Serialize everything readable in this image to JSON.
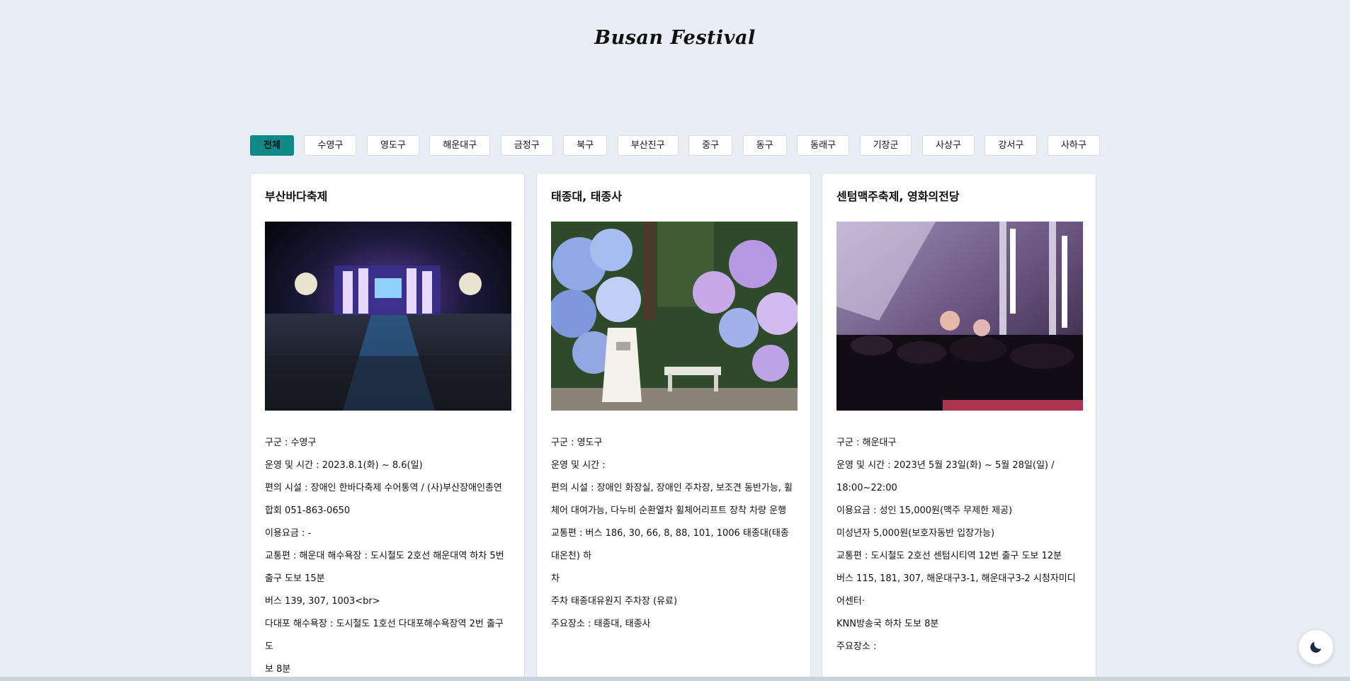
{
  "header": {
    "title": "Busan Festival"
  },
  "filters": [
    {
      "label": "전체",
      "active": true
    },
    {
      "label": "수영구"
    },
    {
      "label": "영도구"
    },
    {
      "label": "해운대구"
    },
    {
      "label": "금정구"
    },
    {
      "label": "북구"
    },
    {
      "label": "부산진구"
    },
    {
      "label": "중구"
    },
    {
      "label": "동구"
    },
    {
      "label": "동래구"
    },
    {
      "label": "기장군"
    },
    {
      "label": "사상구"
    },
    {
      "label": "강서구"
    },
    {
      "label": "사하구"
    }
  ],
  "cards": [
    {
      "title": "부산바다축제",
      "image": "night-concert-stage",
      "lines": [
        "구군 : 수영구",
        "운영 및 시간 : 2023.8.1(화) ~ 8.6(일)",
        "편의 시설 : 장애인 한바다축제 수어통역 / (사)부산장애인총연",
        "합회 051-863-0650",
        "이용요금 : -",
        "교통편 : 해운대 해수욕장 : 도시철도 2호선 해운대역 하차 5번",
        "출구 도보 15분",
        "버스 139, 307, 1003<br>",
        "다대포 해수욕장 : 도시철도 1호선 다대포해수욕장역 2번 출구 도",
        "보 8분"
      ]
    },
    {
      "title": "태종대, 태종사",
      "image": "hydrangea-garden",
      "lines": [
        "구군 : 영도구",
        "운영 및 시간 :",
        "편의 시설 : 장애인 화장실, 장애인 주차장, 보조견 동반가능, 휠",
        "체어 대여가능, 다누비 순환열차 휠체어리프트 장착 차량 운행",
        "교통편 : 버스 186, 30, 66, 8, 88, 101, 1006 태종대(태종대온천) 하",
        "차",
        "주차 태종대유원지 주차장 (유료)",
        "주요장소 : 태종대, 태종사"
      ]
    },
    {
      "title": "센텀맥주축제, 영화의전당",
      "image": "crowd-concert",
      "lines": [
        "구군 : 해운대구",
        "운영 및 시간 : 2023년 5월 23일(화) ~ 5월 28일(일) /",
        "18:00~22:00",
        "이용요금 : 성인 15,000원(맥주 무제한 제공)",
        "미성년자 5,000원(보호자동반 입장가능)",
        "교통편 : 도시철도 2호선 센텀시티역 12번 출구 도보 12분",
        "버스 115, 181, 307, 해운대구3-1, 해운대구3-2 시청자미디어센터·",
        "KNN방송국 하차 도보 8분",
        "주요장소 :"
      ]
    }
  ],
  "theme_toggle": {
    "icon": "moon-icon"
  }
}
